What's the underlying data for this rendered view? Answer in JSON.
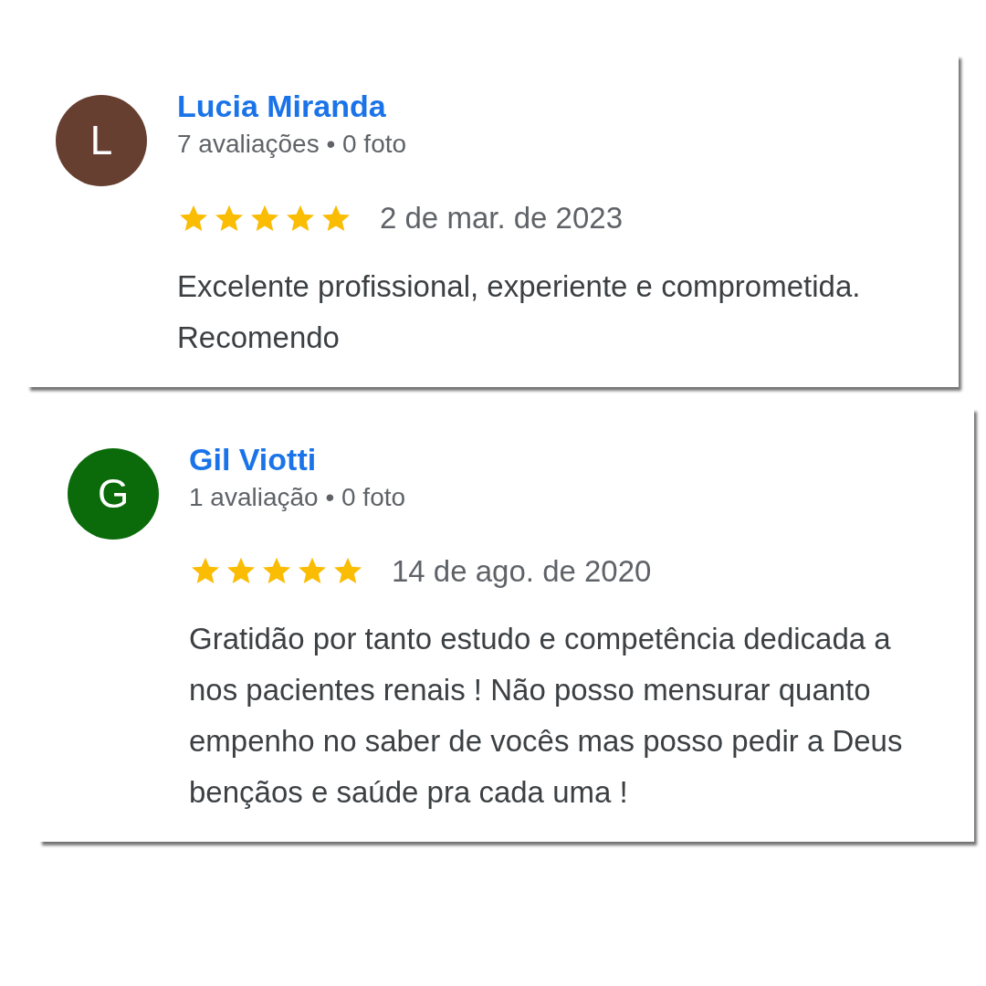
{
  "reviews": [
    {
      "avatar_letter": "L",
      "color": "#673f31",
      "name": "Lucia Miranda",
      "meta": "7 avaliações • 0 foto",
      "stars": 5,
      "date": "2 de mar. de 2023",
      "text": "Excelente profissional, experiente e comprometida. Recomendo"
    },
    {
      "avatar_letter": "G",
      "color": "#0b6b0b",
      "name": "Gil Viotti",
      "meta": "1 avaliação • 0 foto",
      "stars": 5,
      "date": "14 de ago. de 2020",
      "text": "Gratidão por tanto estudo e competência dedicada a nos pacientes renais ! Não posso mensurar quanto empenho no saber de vocês mas posso pedir a Deus bençãos e saúde pra cada uma !"
    }
  ]
}
